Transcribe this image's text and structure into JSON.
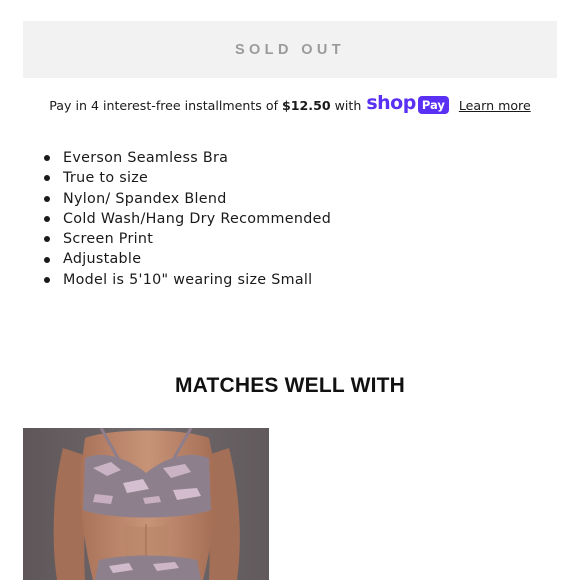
{
  "buy_button": {
    "label": "SOLD OUT"
  },
  "installments": {
    "prefix": "Pay in 4 interest-free installments of",
    "amount": "$12.50",
    "suffix": "with",
    "shop_word": "shop",
    "pay_word": "Pay",
    "link": "Learn more"
  },
  "brand_color": "#5a31f4",
  "features": [
    "Everson Seamless Bra",
    "True to size",
    "Nylon/ Spandex Blend",
    "Cold Wash/Hang Dry Recommended",
    "Screen Print",
    "Adjustable",
    "Model is 5'10\" wearing size Small"
  ],
  "matches": {
    "title": "MATCHES WELL WITH"
  }
}
